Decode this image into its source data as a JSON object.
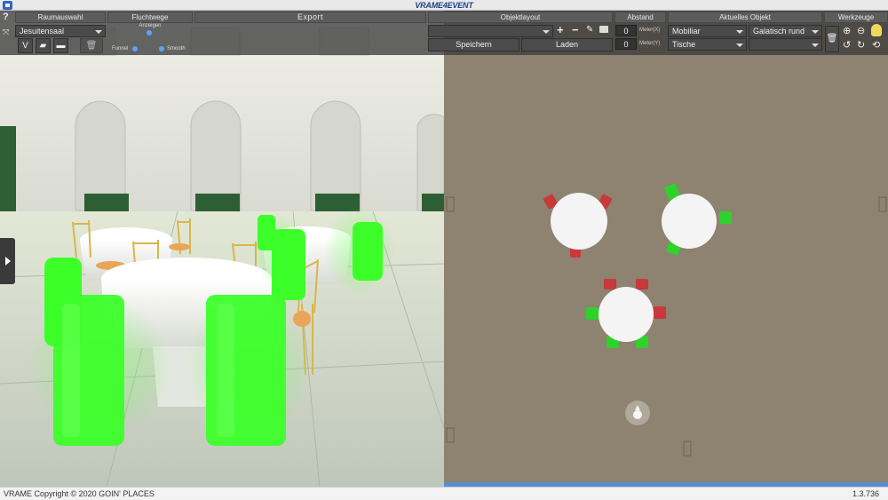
{
  "app": {
    "logo": "VRAME4EVENT",
    "footer_copyright": "VRAME Copyright © 2020 GOIN' PLACES",
    "version": "1.3.736"
  },
  "toolbar": {
    "help_glyph": "?",
    "raumauswahl": {
      "header": "Raumauswahl",
      "room": "Jesuitensaal",
      "v_label": "V"
    },
    "fluchtwege": {
      "header": "Fluchtwege",
      "anzeigen": "Anzeigen",
      "funnel": "Funnel",
      "smooth": "Smooth"
    },
    "export": {
      "label": "Export"
    },
    "objektlayout": {
      "header": "Objektlayout",
      "layout_value": "",
      "save": "Speichern",
      "load": "Laden"
    },
    "abstand": {
      "header": "Abstand",
      "x_value": "0",
      "x_unit": "Meter(X)",
      "y_value": "0",
      "y_unit": "Meter(Y)"
    },
    "aktuelles_objekt": {
      "header": "Aktuelles Objekt",
      "category": "Mobiliar",
      "type": "Tische",
      "model": "Galatisch rund",
      "variant": ""
    },
    "werkzeuge": {
      "header": "Werkzeuge"
    }
  },
  "colors": {
    "chair_glow": "#3cff2a",
    "toolbar_bg": "#3c3c3c",
    "floor_2d": "#8a7e6c",
    "cover_red": "#c9383a"
  },
  "icons": [
    "app-icon",
    "help-icon",
    "expand-icon",
    "chart-icon",
    "folder-open-icon",
    "folder-icon",
    "trash-icon",
    "plus-icon",
    "minus-icon",
    "pen-icon",
    "folder-small-icon",
    "zoom-in-icon",
    "zoom-out-icon",
    "lightbulb-icon",
    "select-icon",
    "rotate-left-icon",
    "rotate-right-icon",
    "reset-icon",
    "menu-toggle-icon",
    "camera-marker-icon"
  ]
}
